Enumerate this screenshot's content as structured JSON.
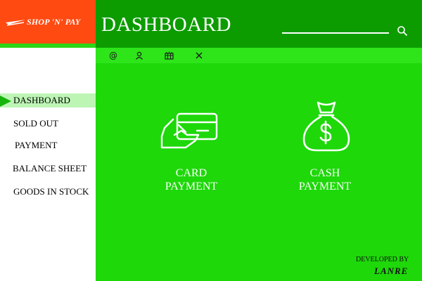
{
  "app": {
    "logo_text": "SHOP 'N' PAY"
  },
  "header": {
    "title": "DASHBOARD"
  },
  "toolbar": {
    "icons": [
      "at-icon",
      "user-icon",
      "building-icon",
      "close-icon"
    ]
  },
  "sidebar": {
    "items": [
      {
        "label": "DASHBOARD",
        "active": true
      },
      {
        "label": "SOLD OUT"
      },
      {
        "label": "PAYMENT"
      },
      {
        "label": "BALANCE SHEET"
      },
      {
        "label": "GOODS IN STOCK"
      }
    ]
  },
  "main": {
    "cards": [
      {
        "line1": "CARD",
        "line2": "PAYMENT",
        "icon": "card-payment-icon"
      },
      {
        "line1": "CASH",
        "line2": "PAYMENT",
        "icon": "money-bag-icon"
      }
    ]
  },
  "footer": {
    "developed_by": "DEVELOPED BY",
    "developer": "LANRE"
  },
  "colors": {
    "logo_bg": "#ff4a12",
    "header_bg": "#0d9c00",
    "toolbar_bg": "#2ee51a",
    "main_bg": "#1ed80a",
    "active_item_bg": "#bdf5b5",
    "active_arrow": "#17b40e"
  }
}
